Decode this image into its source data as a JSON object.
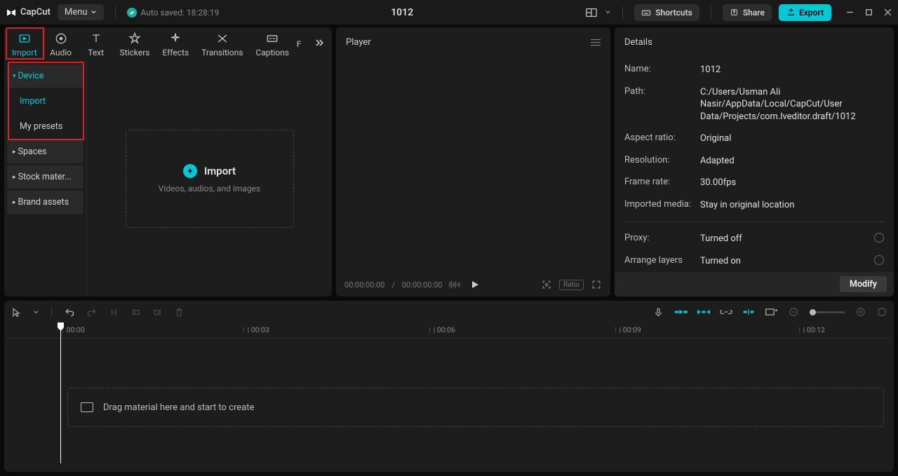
{
  "titlebar": {
    "logo_text": "CapCut",
    "menu": "Menu",
    "auto_saved": "Auto saved: 18:28:19",
    "project_title": "1012",
    "shortcuts": "Shortcuts",
    "share": "Share",
    "export": "Export"
  },
  "tabs": {
    "t0": "Import",
    "t1": "Audio",
    "t2": "Text",
    "t3": "Stickers",
    "t4": "Effects",
    "t5": "Transitions",
    "t6": "Captions",
    "t7": "F"
  },
  "sidebar": {
    "device": "Device",
    "import": "Import",
    "presets": "My presets",
    "spaces": "Spaces",
    "stock": "Stock mater...",
    "brand": "Brand assets"
  },
  "import_box": {
    "label": "Import",
    "sub": "Videos, audios, and images"
  },
  "player": {
    "title": "Player",
    "time_current": "00:00:00:00",
    "time_total": "00:00:00:00",
    "ratio": "Ratio"
  },
  "details": {
    "title": "Details",
    "name_label": "Name:",
    "name_value": "1012",
    "path_label": "Path:",
    "path_value": "C:/Users/Usman Ali Nasir/AppData/Local/CapCut/User Data/Projects/com.lveditor.draft/1012",
    "ar_label": "Aspect ratio:",
    "ar_value": "Original",
    "res_label": "Resolution:",
    "res_value": "Adapted",
    "fps_label": "Frame rate:",
    "fps_value": "30.00fps",
    "imp_label": "Imported media:",
    "imp_value": "Stay in original location",
    "proxy_label": "Proxy:",
    "proxy_value": "Turned off",
    "layers_label": "Arrange layers",
    "layers_value": "Turned on",
    "modify": "Modify"
  },
  "timeline": {
    "marks": {
      "m0": "00:00",
      "m1": "| 00:03",
      "m2": "| 00:06",
      "m3": "| 00:09",
      "m4": "| 00:12"
    },
    "drag_text": "Drag material here and start to create"
  }
}
